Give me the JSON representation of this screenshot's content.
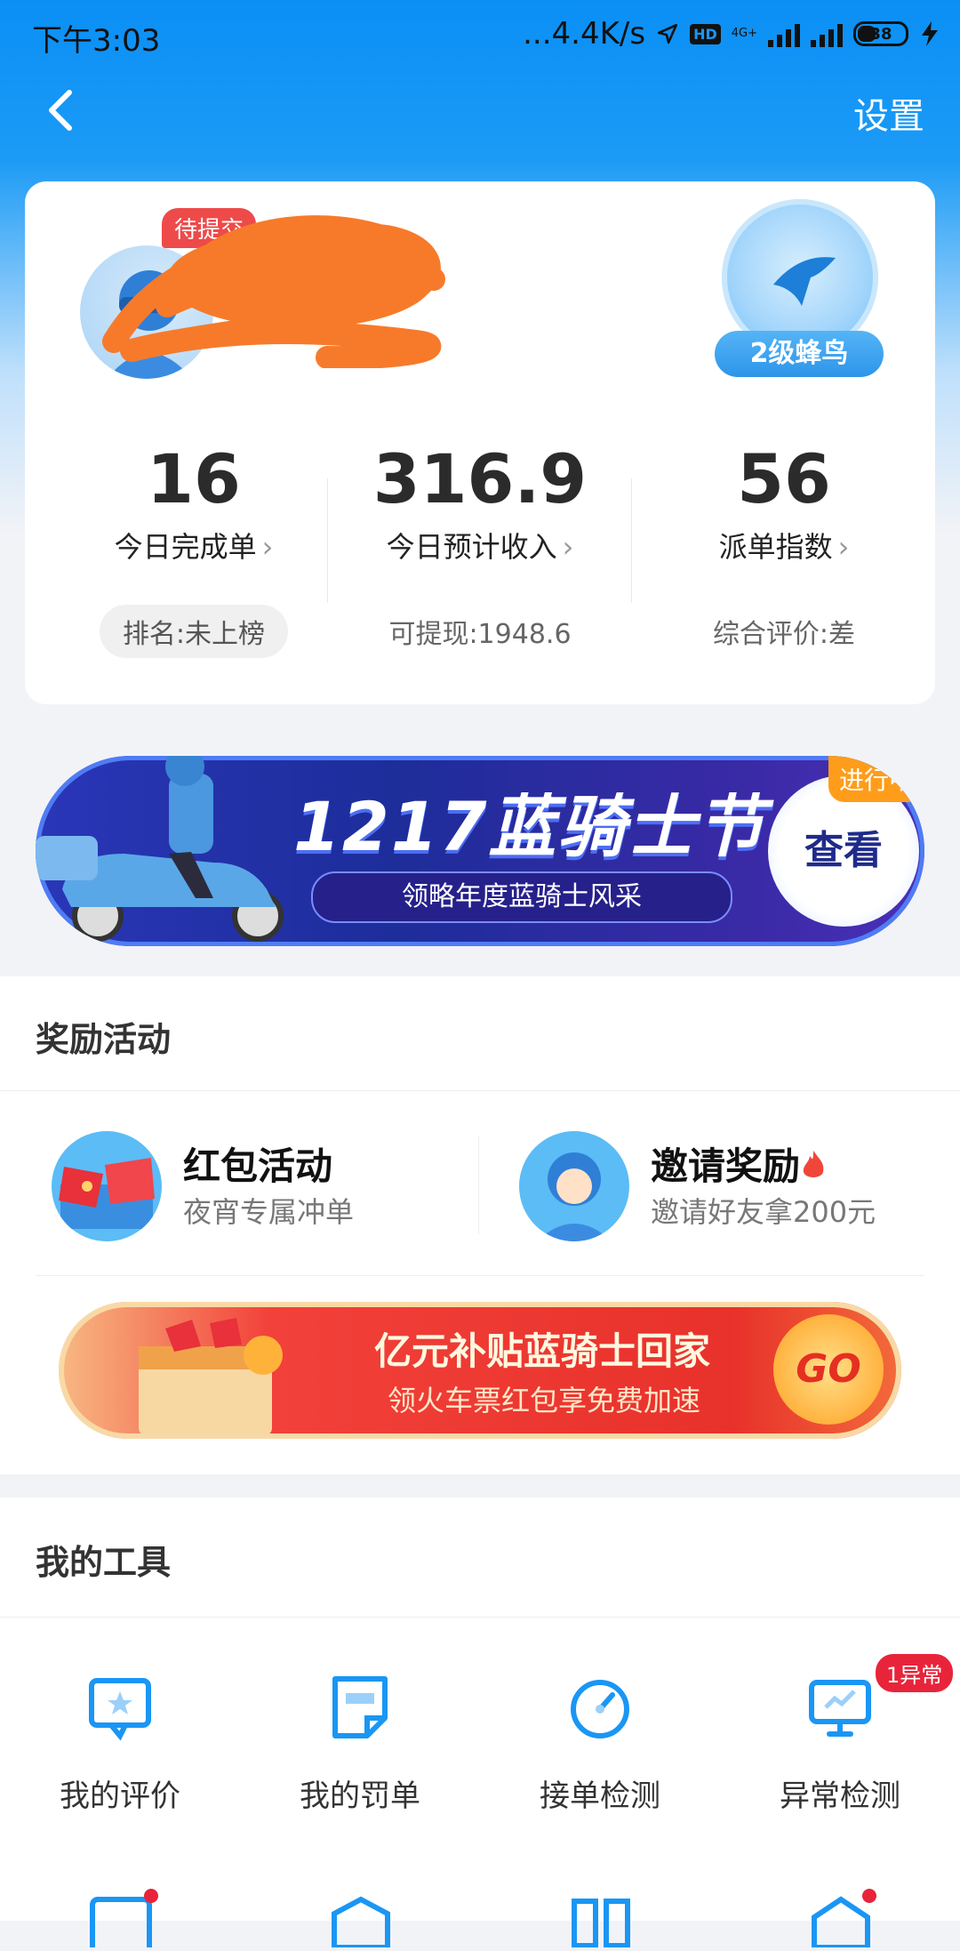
{
  "status_bar": {
    "time": "下午3:03",
    "network_speed": "...4.4K/s",
    "network_type": "4G+",
    "hd_label": "HD",
    "battery": "38"
  },
  "nav": {
    "settings_label": "设置"
  },
  "profile": {
    "pending_badge": "待提交",
    "level_label": "2级蜂鸟"
  },
  "stats": [
    {
      "value": "16",
      "label": "今日完成单",
      "sub": "排名:未上榜"
    },
    {
      "value": "316.9",
      "label": "今日预计收入",
      "sub": "可提现:1948.6"
    },
    {
      "value": "56",
      "label": "派单指数",
      "sub": "综合评价:差"
    }
  ],
  "knight_banner": {
    "title": "1217蓝骑士节",
    "subtitle": "领略年度蓝骑士风采",
    "button": "查看",
    "status": "进行中"
  },
  "rewards": {
    "title": "奖励活动",
    "items": [
      {
        "title": "红包活动",
        "subtitle": "夜宵专属冲单"
      },
      {
        "title": "邀请奖励",
        "subtitle": "邀请好友拿200元"
      }
    ]
  },
  "subsidy_banner": {
    "title": "亿元补贴蓝骑士回家",
    "subtitle": "领火车票红包享免费加速",
    "button": "GO"
  },
  "tools": {
    "title": "我的工具",
    "items": [
      {
        "label": "我的评价",
        "icon": "rating-icon"
      },
      {
        "label": "我的罚单",
        "icon": "ticket-icon"
      },
      {
        "label": "接单检测",
        "icon": "gauge-icon"
      },
      {
        "label": "异常检测",
        "icon": "monitor-icon",
        "badge": "1异常"
      }
    ]
  },
  "colors": {
    "brand_blue": "#1a96f4",
    "badge_red": "#e8243a",
    "warning_orange": "#ff9d1a"
  }
}
